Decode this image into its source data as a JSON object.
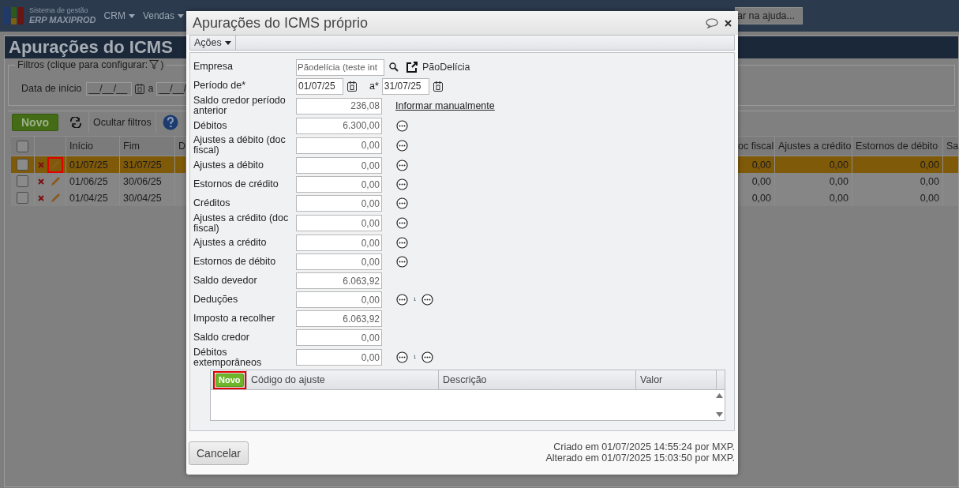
{
  "app": {
    "brand_line1": "Sistema de gestão",
    "brand_line2": "ERP MAXIPROD",
    "menu": [
      {
        "label": "CRM"
      },
      {
        "label": "Vendas"
      }
    ],
    "help_search": {
      "placeholder": "ar na ajuda..."
    }
  },
  "page": {
    "title": "Apurações do ICMS",
    "filters": {
      "legend": "Filtros (clique para configurar:",
      "legend_end": ")",
      "start_label": "Data de início",
      "start_placeholder": "__/__/__",
      "separator": "a",
      "end_placeholder": "__/__/"
    },
    "toolbar": {
      "new_button": "Novo",
      "hide_filters": "Ocultar filtros"
    },
    "table": {
      "all_checked": false,
      "left_columns": [
        "Início",
        "Fim",
        "D"
      ],
      "right_columns": [
        "oc fiscal",
        "Ajustes a crédito",
        "Estornos de débito",
        "Sa"
      ],
      "rows": [
        {
          "selected": true,
          "checked": false,
          "edit_highlighted": true,
          "left_cells": [
            "01/07/25",
            "31/07/25"
          ],
          "right_cells": [
            "0,00",
            "0,00",
            "0,00"
          ]
        },
        {
          "selected": false,
          "checked": false,
          "edit_highlighted": false,
          "left_cells": [
            "01/06/25",
            "30/06/25"
          ],
          "right_cells": [
            "0,00",
            "0,00",
            "0,00"
          ]
        },
        {
          "selected": false,
          "checked": false,
          "edit_highlighted": false,
          "left_cells": [
            "01/04/25",
            "30/04/25"
          ],
          "right_cells": [
            "0,00",
            "0,00",
            "0,00"
          ]
        }
      ]
    }
  },
  "dialog": {
    "title": "Apurações do ICMS próprio",
    "actions_menu": "Ações",
    "fields": [
      {
        "kind": "lookup",
        "label": "Empresa",
        "value": "Pãodelícia (teste int",
        "link": "PãoDelícia"
      },
      {
        "kind": "period",
        "label": "Período de*",
        "value": "01/07/25",
        "separator": "a*",
        "value_to": "31/07/25"
      },
      {
        "kind": "link",
        "label": "Saldo credor período anterior",
        "value": "236,08",
        "link": "Informar manualmente"
      },
      {
        "kind": "more",
        "label": "Débitos",
        "value": "6.300,00"
      },
      {
        "kind": "more",
        "label": "Ajustes a débito (doc fiscal)",
        "value": "0,00"
      },
      {
        "kind": "more",
        "label": "Ajustes a débito",
        "value": "0,00"
      },
      {
        "kind": "more",
        "label": "Estornos de crédito",
        "value": "0,00"
      },
      {
        "kind": "more",
        "label": "Créditos",
        "value": "0,00"
      },
      {
        "kind": "more",
        "label": "Ajustes a crédito (doc fiscal)",
        "value": "0,00"
      },
      {
        "kind": "more",
        "label": "Ajustes a crédito",
        "value": "0,00"
      },
      {
        "kind": "more",
        "label": "Estornos de débito",
        "value": "0,00"
      },
      {
        "kind": "plain",
        "label": "Saldo devedor",
        "value": "6.063,92"
      },
      {
        "kind": "split",
        "label": "Deduções",
        "value": "0,00",
        "marker": "¹"
      },
      {
        "kind": "plain",
        "label": "Imposto a recolher",
        "value": "6.063,92"
      },
      {
        "kind": "plain",
        "label": "Saldo credor",
        "value": "0,00"
      },
      {
        "kind": "split",
        "label": "Débitos extemporâneos",
        "value": "0,00",
        "marker": "¹"
      }
    ],
    "adjustments": {
      "new_button": "Novo",
      "new_highlighted": true,
      "columns": [
        "Código do ajuste",
        "Descrição",
        "Valor"
      ]
    },
    "cancel_button": "Cancelar",
    "created": "Criado em 01/07/2025 14:55:24 por MXP.",
    "modified": "Alterado em 01/07/2025 15:03:50 por MXP."
  }
}
